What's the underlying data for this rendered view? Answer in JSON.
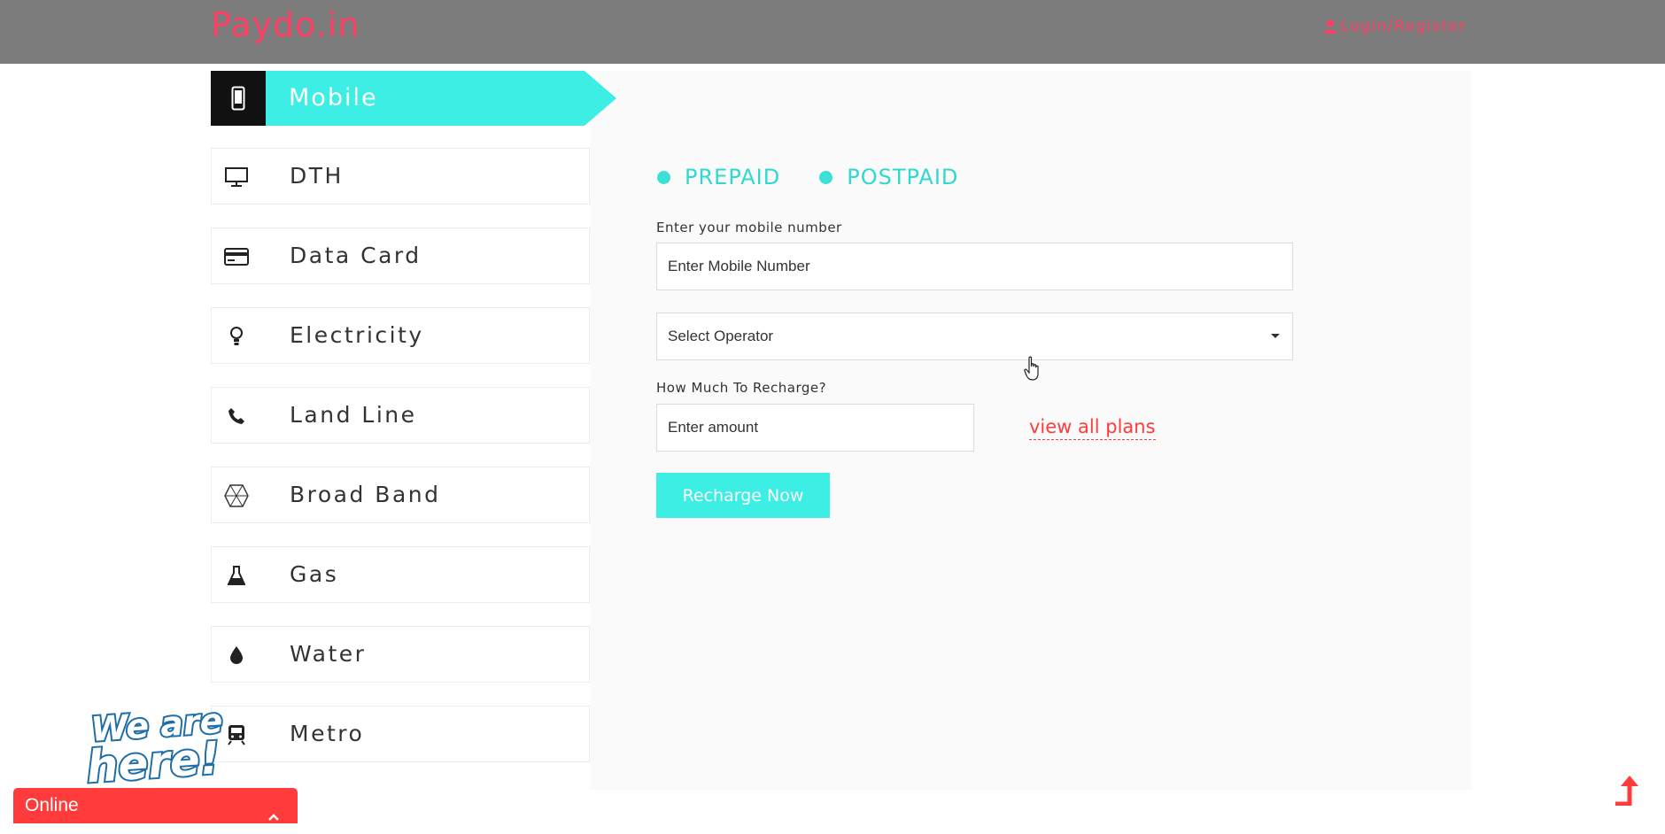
{
  "header": {
    "logo": "Paydo.in",
    "login_label": "Login/Register"
  },
  "sidebar": {
    "active": {
      "label": "Mobile",
      "icon": "mobile-icon"
    },
    "items": [
      {
        "label": "DTH",
        "icon": "monitor-icon"
      },
      {
        "label": "Data Card",
        "icon": "credit-card-icon"
      },
      {
        "label": "Electricity",
        "icon": "bulb-icon"
      },
      {
        "label": "Land Line",
        "icon": "phone-icon"
      },
      {
        "label": "Broad Band",
        "icon": "network-icon"
      },
      {
        "label": "Gas",
        "icon": "flask-icon"
      },
      {
        "label": "Water",
        "icon": "drop-icon"
      },
      {
        "label": "Metro",
        "icon": "train-icon"
      }
    ]
  },
  "form": {
    "plan_types": [
      "PREPAID",
      "POSTPAID"
    ],
    "mobile_label": "Enter your mobile number",
    "mobile_placeholder": "Enter Mobile Number",
    "operator_placeholder": "Select Operator",
    "amount_label": "How Much To Recharge?",
    "amount_placeholder": "Enter amount",
    "plans_link": "view all plans",
    "submit_label": "Recharge Now"
  },
  "chat": {
    "badge_text": "We are here!",
    "status": "Online"
  },
  "colors": {
    "header_bg": "#7c7c7c",
    "brand": "#ff4066",
    "accent": "#3ceee4",
    "chat": "#ff3b3b"
  }
}
